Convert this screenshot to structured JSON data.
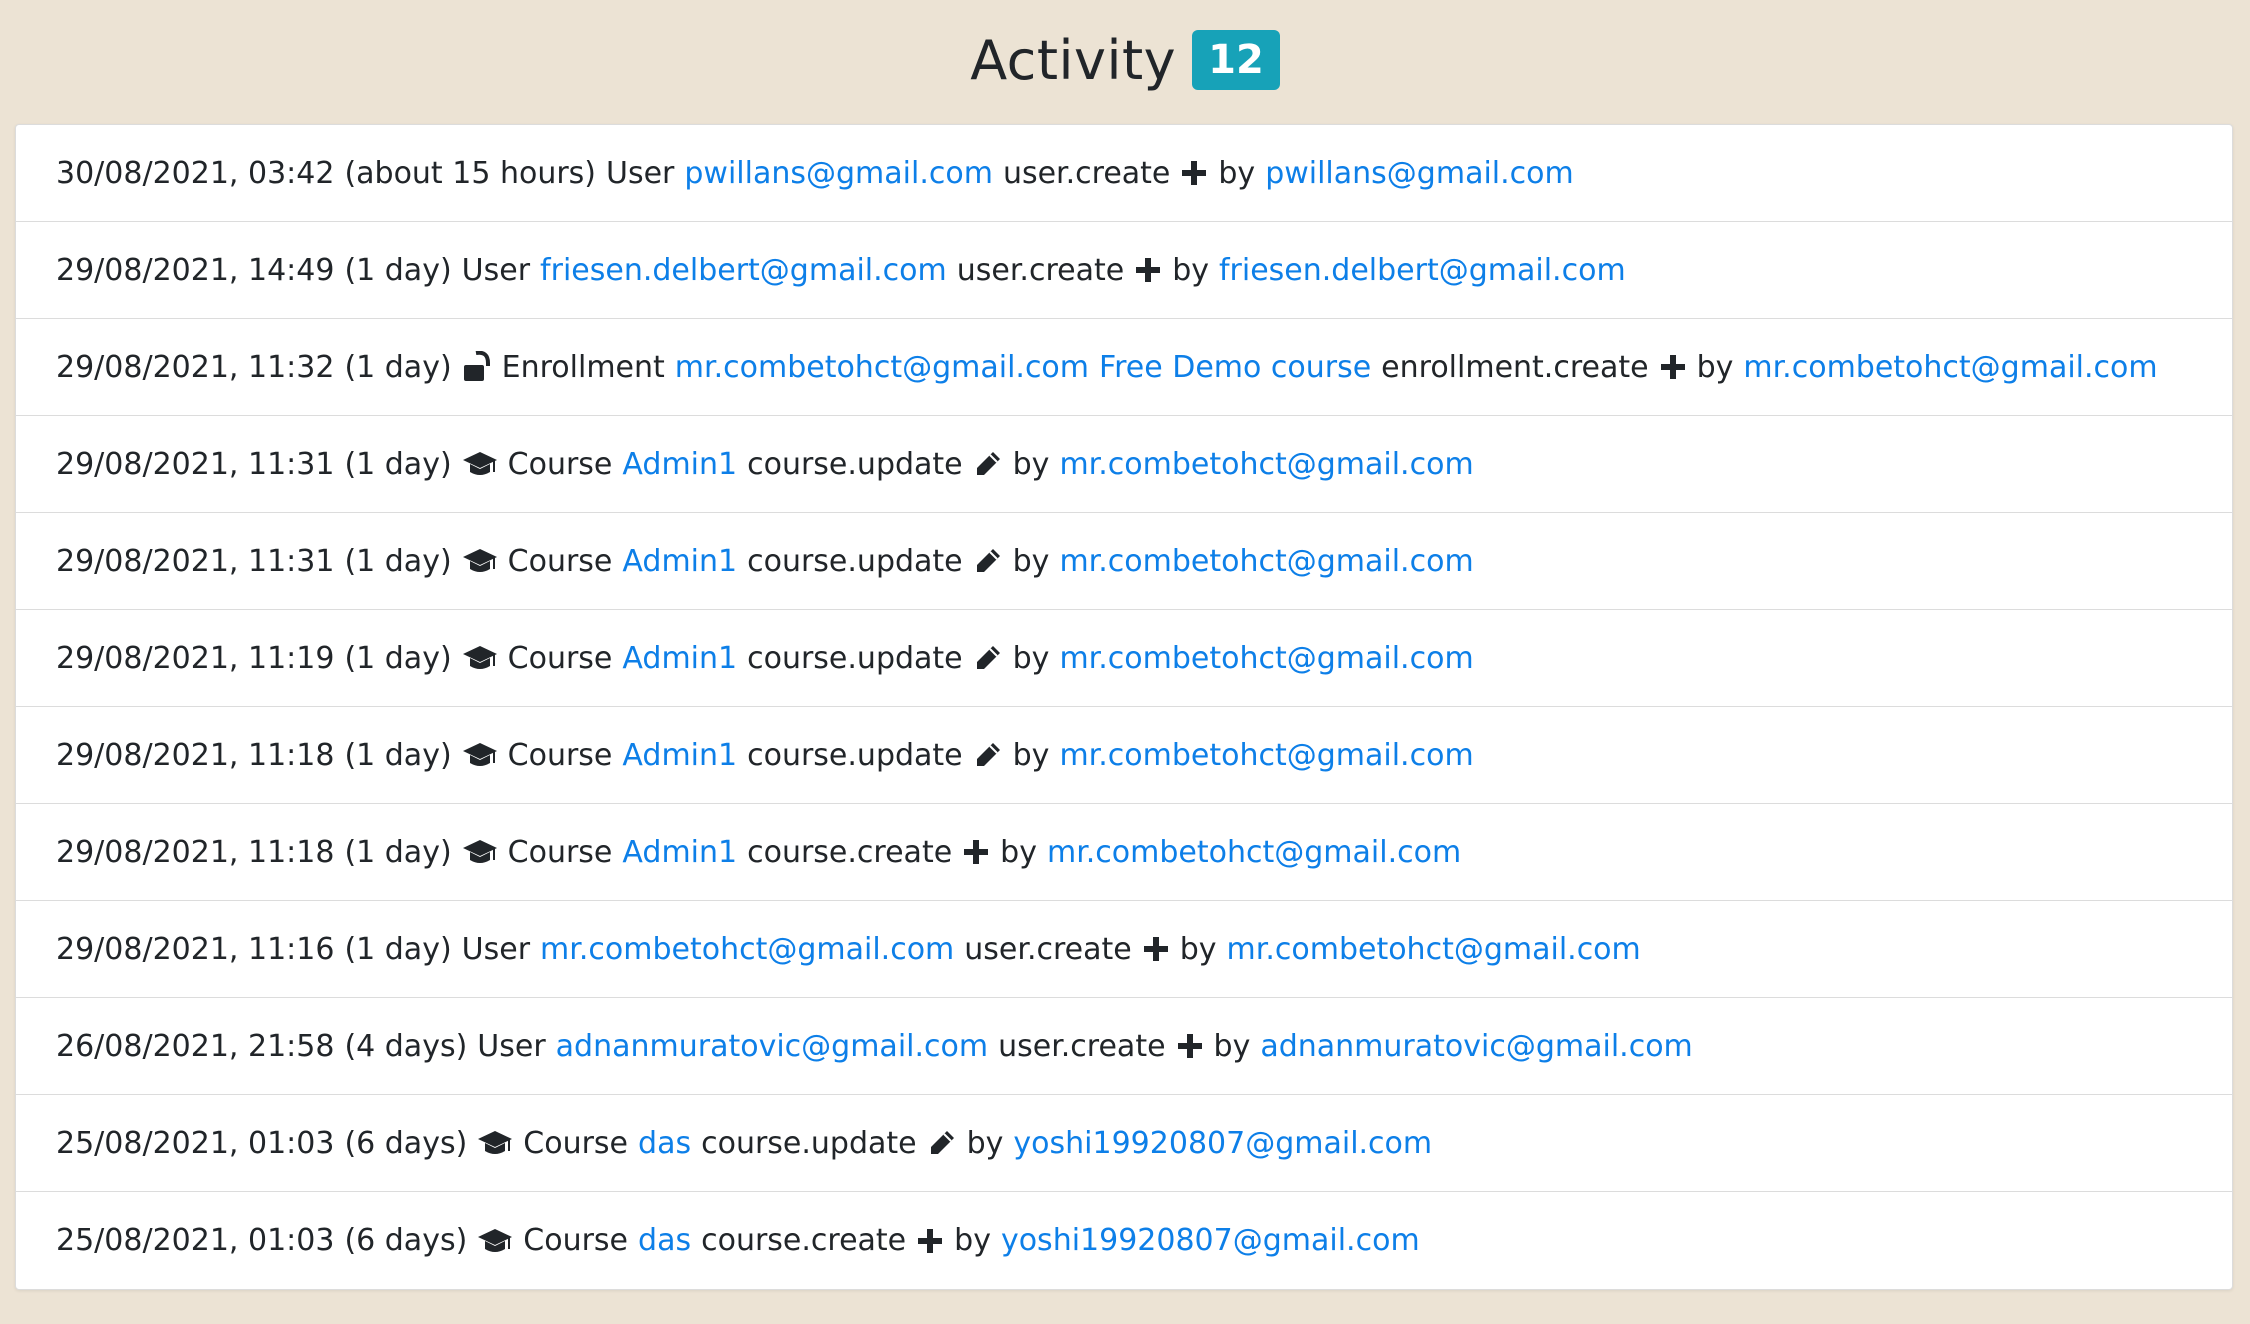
{
  "header": {
    "title": "Activity",
    "count": "12"
  },
  "colors": {
    "background": "#ece3d4",
    "badge": "#17a2b8",
    "link": "#0d7fe8",
    "text": "#212529"
  },
  "activities": [
    {
      "timestamp": "30/08/2021, 03:42",
      "relative": "(about 15 hours)",
      "type_icon": "",
      "type_label": "User",
      "subject_links": [
        "pwillans@gmail.com"
      ],
      "action": "user.create",
      "action_icon": "plus-icon",
      "by_label": "by",
      "actor": "pwillans@gmail.com"
    },
    {
      "timestamp": "29/08/2021, 14:49",
      "relative": "(1 day)",
      "type_icon": "",
      "type_label": "User",
      "subject_links": [
        "friesen.delbert@gmail.com"
      ],
      "action": "user.create",
      "action_icon": "plus-icon",
      "by_label": "by",
      "actor": "friesen.delbert@gmail.com"
    },
    {
      "timestamp": "29/08/2021, 11:32",
      "relative": "(1 day)",
      "type_icon": "unlock-icon",
      "type_label": "Enrollment",
      "subject_links": [
        "mr.combetohct@gmail.com",
        "Free Demo course"
      ],
      "action": "enrollment.create",
      "action_icon": "plus-icon",
      "by_label": "by",
      "actor": "mr.combetohct@gmail.com"
    },
    {
      "timestamp": "29/08/2021, 11:31",
      "relative": "(1 day)",
      "type_icon": "graduation-cap-icon",
      "type_label": "Course",
      "subject_links": [
        "Admin1"
      ],
      "action": "course.update",
      "action_icon": "pencil-icon",
      "by_label": "by",
      "actor": "mr.combetohct@gmail.com"
    },
    {
      "timestamp": "29/08/2021, 11:31",
      "relative": "(1 day)",
      "type_icon": "graduation-cap-icon",
      "type_label": "Course",
      "subject_links": [
        "Admin1"
      ],
      "action": "course.update",
      "action_icon": "pencil-icon",
      "by_label": "by",
      "actor": "mr.combetohct@gmail.com"
    },
    {
      "timestamp": "29/08/2021, 11:19",
      "relative": "(1 day)",
      "type_icon": "graduation-cap-icon",
      "type_label": "Course",
      "subject_links": [
        "Admin1"
      ],
      "action": "course.update",
      "action_icon": "pencil-icon",
      "by_label": "by",
      "actor": "mr.combetohct@gmail.com"
    },
    {
      "timestamp": "29/08/2021, 11:18",
      "relative": "(1 day)",
      "type_icon": "graduation-cap-icon",
      "type_label": "Course",
      "subject_links": [
        "Admin1"
      ],
      "action": "course.update",
      "action_icon": "pencil-icon",
      "by_label": "by",
      "actor": "mr.combetohct@gmail.com"
    },
    {
      "timestamp": "29/08/2021, 11:18",
      "relative": "(1 day)",
      "type_icon": "graduation-cap-icon",
      "type_label": "Course",
      "subject_links": [
        "Admin1"
      ],
      "action": "course.create",
      "action_icon": "plus-icon",
      "by_label": "by",
      "actor": "mr.combetohct@gmail.com"
    },
    {
      "timestamp": "29/08/2021, 11:16",
      "relative": "(1 day)",
      "type_icon": "",
      "type_label": "User",
      "subject_links": [
        "mr.combetohct@gmail.com"
      ],
      "action": "user.create",
      "action_icon": "plus-icon",
      "by_label": "by",
      "actor": "mr.combetohct@gmail.com"
    },
    {
      "timestamp": "26/08/2021, 21:58",
      "relative": "(4 days)",
      "type_icon": "",
      "type_label": "User",
      "subject_links": [
        "adnanmuratovic@gmail.com"
      ],
      "action": "user.create",
      "action_icon": "plus-icon",
      "by_label": "by",
      "actor": "adnanmuratovic@gmail.com"
    },
    {
      "timestamp": "25/08/2021, 01:03",
      "relative": "(6 days)",
      "type_icon": "graduation-cap-icon",
      "type_label": "Course",
      "subject_links": [
        "das"
      ],
      "action": "course.update",
      "action_icon": "pencil-icon",
      "by_label": "by",
      "actor": "yoshi19920807@gmail.com"
    },
    {
      "timestamp": "25/08/2021, 01:03",
      "relative": "(6 days)",
      "type_icon": "graduation-cap-icon",
      "type_label": "Course",
      "subject_links": [
        "das"
      ],
      "action": "course.create",
      "action_icon": "plus-icon",
      "by_label": "by",
      "actor": "yoshi19920807@gmail.com"
    }
  ]
}
